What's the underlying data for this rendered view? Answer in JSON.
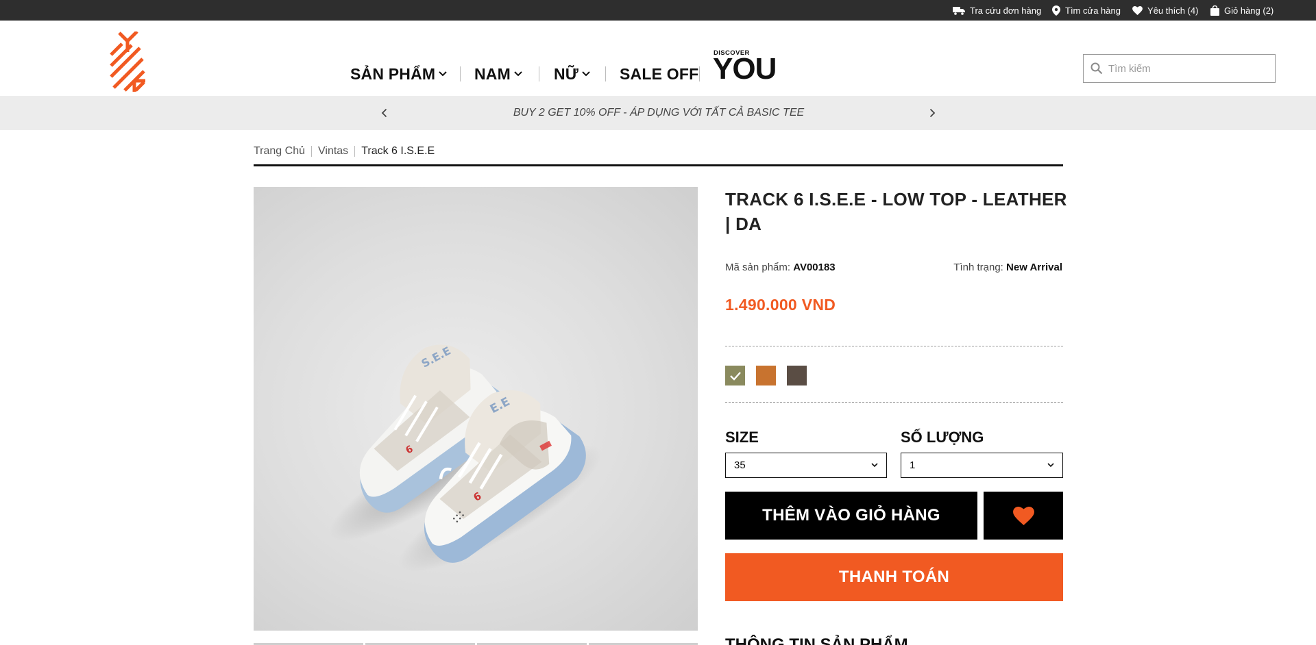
{
  "topbar": {
    "order_lookup": "Tra cứu đơn hàng",
    "store_finder": "Tìm cửa hàng",
    "wishlist": "Yêu thích (4)",
    "cart": "Giỏ hàng (2)"
  },
  "header": {
    "nav": [
      {
        "label": "SẢN PHẨM",
        "has_dropdown": true
      },
      {
        "label": "NAM",
        "has_dropdown": true
      },
      {
        "label": "NỮ",
        "has_dropdown": true
      },
      {
        "label": "SALE OFF",
        "has_dropdown": false
      }
    ],
    "discover_small": "DISCOVER",
    "discover_big": "YOU",
    "search_placeholder": "Tìm kiếm"
  },
  "promo": {
    "text": "BUY 2 GET 10% OFF - ÁP DỤNG VỚI TẤT CẢ BASIC TEE"
  },
  "breadcrumb": [
    "Trang Chủ",
    "Vintas",
    "Track 6 I.S.E.E"
  ],
  "product": {
    "title": "TRACK 6 I.S.E.E - LOW TOP - LEATHER | DA",
    "sku_label": "Mã sản phẩm:",
    "sku": "AV00183",
    "status_label": "Tình trạng:",
    "status": "New Arrival",
    "price": "1.490.000 VND",
    "colors": [
      "#8a8a5e",
      "#c8732f",
      "#5a4d44"
    ],
    "selected_color_index": 0,
    "size_label": "SIZE",
    "size_value": "35",
    "qty_label": "SỐ LƯỢNG",
    "qty_value": "1",
    "add_to_cart": "THÊM VÀO GIỎ HÀNG",
    "checkout": "THANH TOÁN",
    "info_title": "THÔNG TIN SẢN PHẨM"
  },
  "colors": {
    "accent": "#f15a22",
    "topbar": "#2e2e2e",
    "promo_bg": "#ececec"
  }
}
